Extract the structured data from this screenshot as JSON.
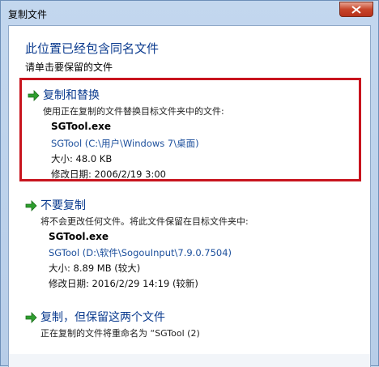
{
  "window": {
    "title": "复制文件"
  },
  "header": {
    "heading": "此位置已经包含同名文件",
    "subheading": "请单击要保留的文件"
  },
  "options": [
    {
      "title": "复制和替换",
      "description": "使用正在复制的文件替换目标文件夹中的文件:",
      "file_name": "SGTool.exe",
      "path": "SGTool (C:\\用户\\Windows 7\\桌面)",
      "size": "大小: 48.0 KB",
      "modified": "修改日期: 2006/2/19 3:00"
    },
    {
      "title": "不要复制",
      "description": "将不会更改任何文件。将此文件保留在目标文件夹中:",
      "file_name": "SGTool.exe",
      "path": "SGTool (D:\\软件\\SogouInput\\7.9.0.7504)",
      "size": "大小: 8.89 MB (较大)",
      "modified": "修改日期: 2016/2/29 14:19 (较新)"
    },
    {
      "title": "复制，但保留这两个文件",
      "description": "正在复制的文件将重命名为 “SGTool (2)"
    }
  ],
  "colors": {
    "title_blue": "#0b3b8f",
    "highlight_red": "#c8141e",
    "arrow_green": "#2e9e2e"
  }
}
